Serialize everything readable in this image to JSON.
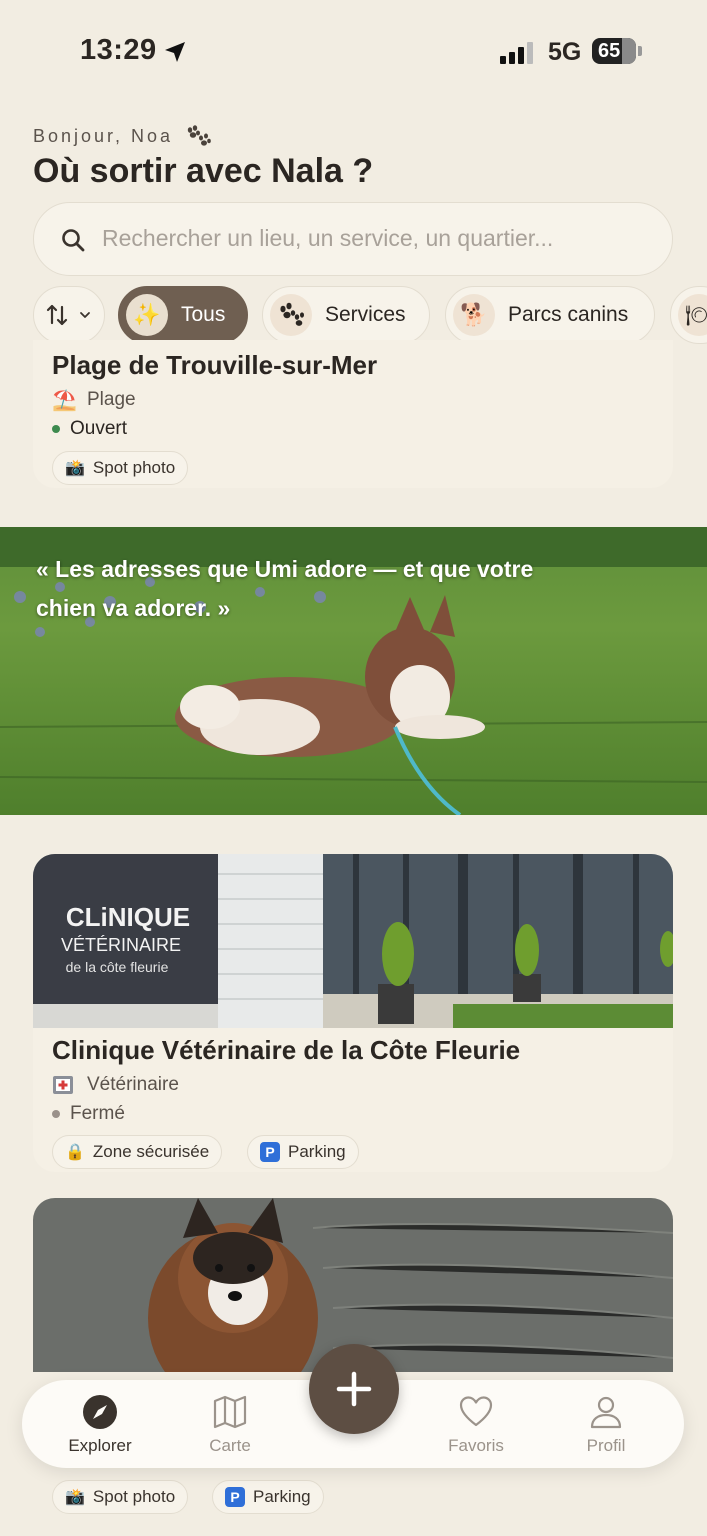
{
  "status_bar": {
    "time": "13:29",
    "network": "5G",
    "battery": "65"
  },
  "header": {
    "greeting": "Bonjour, Noa",
    "title": "Où sortir avec Nala ?"
  },
  "search": {
    "placeholder": "Rechercher un lieu, un service, un quartier..."
  },
  "filters": [
    {
      "label": "Tous",
      "active": true
    },
    {
      "label": "Services",
      "active": false
    },
    {
      "label": "Parcs canins",
      "active": false
    }
  ],
  "places": [
    {
      "title": "Plage de Trouville-sur-Mer",
      "category": "Plage",
      "status": "Ouvert",
      "tags": [
        "Spot photo"
      ]
    },
    {
      "title": "Clinique Vétérinaire de la Côte Fleurie",
      "category": "Vétérinaire",
      "status": "Fermé",
      "tags": [
        "Zone sécurisée",
        "Parking"
      ],
      "sign_line1": "CLiNIQUE",
      "sign_line2": "VÉTÉRINAIRE",
      "sign_line3": "de la côte fleurie"
    },
    {
      "tags": [
        "Spot photo",
        "Parking"
      ]
    }
  ],
  "hero": {
    "quote": "« Les adresses que Umi adore — et que votre chien va adorer. »"
  },
  "tabbar": {
    "explore": "Explorer",
    "map": "Carte",
    "favorites": "Favoris",
    "profile": "Profil"
  },
  "colors": {
    "background": "#f2ede2",
    "accent": "#6f5f51",
    "fab": "#5d4e43",
    "open": "#3d8a4e"
  }
}
